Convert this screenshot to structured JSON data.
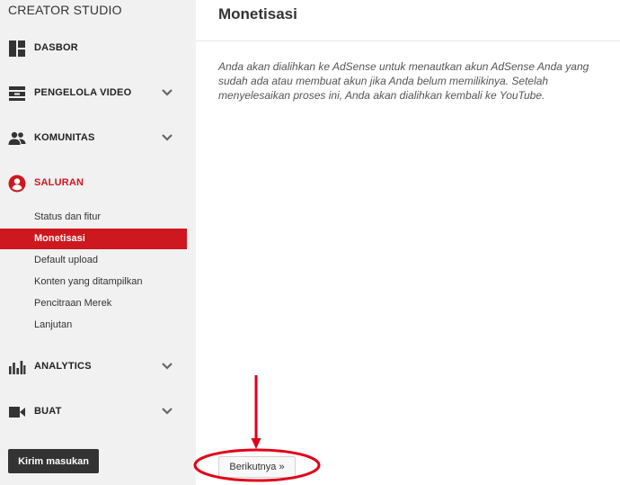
{
  "sidebar": {
    "title": "CREATOR STUDIO",
    "nav": [
      {
        "label": "DASBOR",
        "icon": "dashboard-icon"
      },
      {
        "label": "PENGELOLA VIDEO",
        "icon": "video-manager-icon"
      },
      {
        "label": "KOMUNITAS",
        "icon": "community-icon"
      },
      {
        "label": "SALURAN",
        "icon": "channel-icon"
      },
      {
        "label": "ANALYTICS",
        "icon": "analytics-icon"
      },
      {
        "label": "BUAT",
        "icon": "create-video-icon"
      }
    ],
    "subitems": [
      {
        "label": "Status dan fitur"
      },
      {
        "label": "Monetisasi"
      },
      {
        "label": "Default upload"
      },
      {
        "label": "Konten yang ditampilkan"
      },
      {
        "label": "Pencitraan Merek"
      },
      {
        "label": "Lanjutan"
      }
    ],
    "feedback_label": "Kirim masukan"
  },
  "main": {
    "title": "Monetisasi",
    "description": "Anda akan dialihkan ke AdSense untuk menautkan akun AdSense Anda yang sudah ada atau membuat akun jika Anda belum memilikinya. Setelah menyelesaikan proses ini, Anda akan dialihkan kembali ke YouTube.",
    "next_label": "Berikutnya »"
  },
  "colors": {
    "accent": "#cc181e",
    "annotation": "#e0001a"
  }
}
